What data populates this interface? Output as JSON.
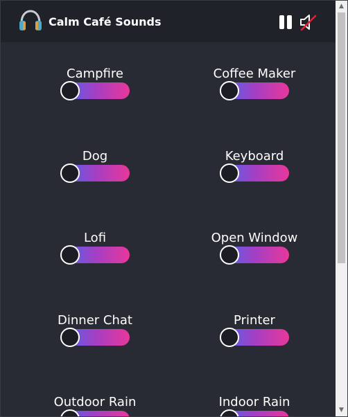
{
  "header": {
    "title": "Calm Café Sounds",
    "logo_icon": "headphones-icon",
    "pause_icon": "pause-icon",
    "mute_icon": "speaker-muted-icon"
  },
  "colors": {
    "background": "#282b33",
    "header_background": "#1f2228",
    "toggle_gradient_start": "#5562e8",
    "toggle_gradient_end": "#e8379a",
    "mute_slash": "#e0213b"
  },
  "sounds": [
    {
      "label": "Campfire",
      "on": false
    },
    {
      "label": "Coffee Maker",
      "on": false
    },
    {
      "label": "Dog",
      "on": false
    },
    {
      "label": "Keyboard",
      "on": false
    },
    {
      "label": "Lofi",
      "on": false
    },
    {
      "label": "Open Window",
      "on": false
    },
    {
      "label": "Dinner Chat",
      "on": false
    },
    {
      "label": "Printer",
      "on": false
    },
    {
      "label": "Outdoor Rain",
      "on": false
    },
    {
      "label": "Indoor Rain",
      "on": false
    }
  ],
  "scrollbar": {
    "up_icon": "scroll-up-arrow-icon",
    "down_icon": "scroll-down-arrow-icon"
  }
}
